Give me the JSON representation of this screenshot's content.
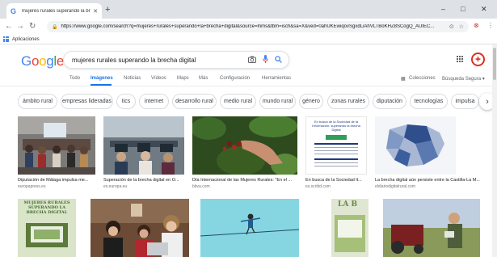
{
  "browser": {
    "tab_title": "mujeres rurales superando la bre",
    "tab_favicon": "G",
    "new_tab_glyph": "+",
    "url": "https://www.google.com/search?q=mujeres+rurales+superando+la+brecha+digital&source=lnms&tbm=isch&sa=X&ved=0ahUKEwiqovSgxdLiAhVLTBoKHZ8SCogQ_AUIEC...",
    "bookmarks_label": "Aplicaciones",
    "window_controls": [
      "–",
      "□",
      "✕"
    ]
  },
  "google": {
    "logo_letters": [
      {
        "ch": "G",
        "color": "#4285f4"
      },
      {
        "ch": "o",
        "color": "#ea4335"
      },
      {
        "ch": "o",
        "color": "#fbbc05"
      },
      {
        "ch": "g",
        "color": "#4285f4"
      },
      {
        "ch": "l",
        "color": "#34a853"
      },
      {
        "ch": "e",
        "color": "#ea4335"
      }
    ],
    "query": "mujeres rurales superando la brecha digital"
  },
  "search_tabs": [
    "Todo",
    "Imágenes",
    "Noticias",
    "Vídeos",
    "Maps",
    "Más",
    "Configuración",
    "Herramientas"
  ],
  "tab_right": {
    "collections": "Colecciones",
    "safe_search": "Búsqueda Segura ▾"
  },
  "chips": [
    "ámbito rural",
    "empresas lideradas",
    "tics",
    "internet",
    "desarrollo rural",
    "medio rural",
    "mundo rural",
    "género",
    "zonas rurales",
    "diputación",
    "tecnologías",
    "impulsa"
  ],
  "results_row1": [
    {
      "caption": "Diputación de Málaga impulsa me...",
      "source": "europapress.es"
    },
    {
      "caption": "Superación de la brecha digital en O...",
      "source": "es.europa.eu"
    },
    {
      "caption": "Día Internacional de las Mujeres Rurales: \"En el ...",
      "source": "bbva.com"
    },
    {
      "caption": "En busca de la Sociedad lt...",
      "source": "es.scribd.com"
    },
    {
      "caption": "La brecha digital aún persiste entre la Castilla-La M...",
      "source": "eldiariodigitalrural.com"
    }
  ],
  "thumb_texts": {
    "doc_title": "En busca de la Sociedad de la Información: superando la brecha Digital",
    "sign_text": "MUJERES RURALES SUPERANDO LA BRECHA DIGITAL",
    "lab_text": "LA B"
  },
  "colors": {
    "accent": "#1a73e8",
    "link_gray": "#5f6368"
  }
}
